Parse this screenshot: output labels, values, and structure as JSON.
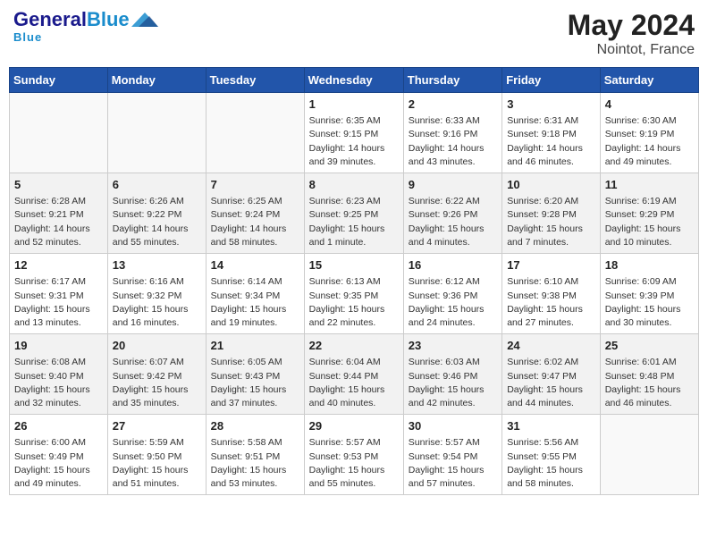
{
  "header": {
    "logo_text_general": "General",
    "logo_text_blue": "Blue",
    "month_year": "May 2024",
    "location": "Nointot, France"
  },
  "weekdays": [
    "Sunday",
    "Monday",
    "Tuesday",
    "Wednesday",
    "Thursday",
    "Friday",
    "Saturday"
  ],
  "weeks": [
    [
      {
        "day": "",
        "info": ""
      },
      {
        "day": "",
        "info": ""
      },
      {
        "day": "",
        "info": ""
      },
      {
        "day": "1",
        "info": "Sunrise: 6:35 AM\nSunset: 9:15 PM\nDaylight: 14 hours\nand 39 minutes."
      },
      {
        "day": "2",
        "info": "Sunrise: 6:33 AM\nSunset: 9:16 PM\nDaylight: 14 hours\nand 43 minutes."
      },
      {
        "day": "3",
        "info": "Sunrise: 6:31 AM\nSunset: 9:18 PM\nDaylight: 14 hours\nand 46 minutes."
      },
      {
        "day": "4",
        "info": "Sunrise: 6:30 AM\nSunset: 9:19 PM\nDaylight: 14 hours\nand 49 minutes."
      }
    ],
    [
      {
        "day": "5",
        "info": "Sunrise: 6:28 AM\nSunset: 9:21 PM\nDaylight: 14 hours\nand 52 minutes."
      },
      {
        "day": "6",
        "info": "Sunrise: 6:26 AM\nSunset: 9:22 PM\nDaylight: 14 hours\nand 55 minutes."
      },
      {
        "day": "7",
        "info": "Sunrise: 6:25 AM\nSunset: 9:24 PM\nDaylight: 14 hours\nand 58 minutes."
      },
      {
        "day": "8",
        "info": "Sunrise: 6:23 AM\nSunset: 9:25 PM\nDaylight: 15 hours\nand 1 minute."
      },
      {
        "day": "9",
        "info": "Sunrise: 6:22 AM\nSunset: 9:26 PM\nDaylight: 15 hours\nand 4 minutes."
      },
      {
        "day": "10",
        "info": "Sunrise: 6:20 AM\nSunset: 9:28 PM\nDaylight: 15 hours\nand 7 minutes."
      },
      {
        "day": "11",
        "info": "Sunrise: 6:19 AM\nSunset: 9:29 PM\nDaylight: 15 hours\nand 10 minutes."
      }
    ],
    [
      {
        "day": "12",
        "info": "Sunrise: 6:17 AM\nSunset: 9:31 PM\nDaylight: 15 hours\nand 13 minutes."
      },
      {
        "day": "13",
        "info": "Sunrise: 6:16 AM\nSunset: 9:32 PM\nDaylight: 15 hours\nand 16 minutes."
      },
      {
        "day": "14",
        "info": "Sunrise: 6:14 AM\nSunset: 9:34 PM\nDaylight: 15 hours\nand 19 minutes."
      },
      {
        "day": "15",
        "info": "Sunrise: 6:13 AM\nSunset: 9:35 PM\nDaylight: 15 hours\nand 22 minutes."
      },
      {
        "day": "16",
        "info": "Sunrise: 6:12 AM\nSunset: 9:36 PM\nDaylight: 15 hours\nand 24 minutes."
      },
      {
        "day": "17",
        "info": "Sunrise: 6:10 AM\nSunset: 9:38 PM\nDaylight: 15 hours\nand 27 minutes."
      },
      {
        "day": "18",
        "info": "Sunrise: 6:09 AM\nSunset: 9:39 PM\nDaylight: 15 hours\nand 30 minutes."
      }
    ],
    [
      {
        "day": "19",
        "info": "Sunrise: 6:08 AM\nSunset: 9:40 PM\nDaylight: 15 hours\nand 32 minutes."
      },
      {
        "day": "20",
        "info": "Sunrise: 6:07 AM\nSunset: 9:42 PM\nDaylight: 15 hours\nand 35 minutes."
      },
      {
        "day": "21",
        "info": "Sunrise: 6:05 AM\nSunset: 9:43 PM\nDaylight: 15 hours\nand 37 minutes."
      },
      {
        "day": "22",
        "info": "Sunrise: 6:04 AM\nSunset: 9:44 PM\nDaylight: 15 hours\nand 40 minutes."
      },
      {
        "day": "23",
        "info": "Sunrise: 6:03 AM\nSunset: 9:46 PM\nDaylight: 15 hours\nand 42 minutes."
      },
      {
        "day": "24",
        "info": "Sunrise: 6:02 AM\nSunset: 9:47 PM\nDaylight: 15 hours\nand 44 minutes."
      },
      {
        "day": "25",
        "info": "Sunrise: 6:01 AM\nSunset: 9:48 PM\nDaylight: 15 hours\nand 46 minutes."
      }
    ],
    [
      {
        "day": "26",
        "info": "Sunrise: 6:00 AM\nSunset: 9:49 PM\nDaylight: 15 hours\nand 49 minutes."
      },
      {
        "day": "27",
        "info": "Sunrise: 5:59 AM\nSunset: 9:50 PM\nDaylight: 15 hours\nand 51 minutes."
      },
      {
        "day": "28",
        "info": "Sunrise: 5:58 AM\nSunset: 9:51 PM\nDaylight: 15 hours\nand 53 minutes."
      },
      {
        "day": "29",
        "info": "Sunrise: 5:57 AM\nSunset: 9:53 PM\nDaylight: 15 hours\nand 55 minutes."
      },
      {
        "day": "30",
        "info": "Sunrise: 5:57 AM\nSunset: 9:54 PM\nDaylight: 15 hours\nand 57 minutes."
      },
      {
        "day": "31",
        "info": "Sunrise: 5:56 AM\nSunset: 9:55 PM\nDaylight: 15 hours\nand 58 minutes."
      },
      {
        "day": "",
        "info": ""
      }
    ]
  ]
}
